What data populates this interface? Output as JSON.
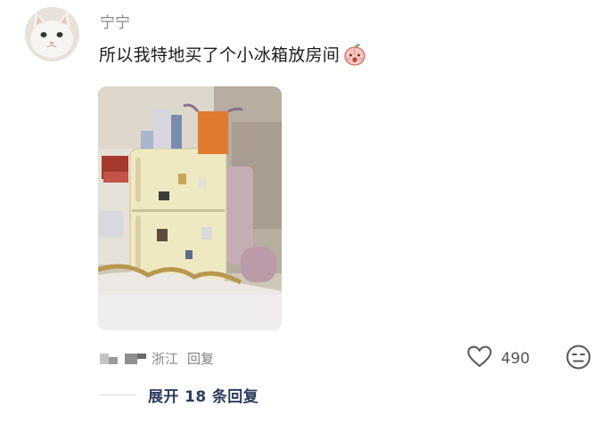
{
  "comment": {
    "username": "宁宁",
    "text": "所以我特地买了个小冰箱放房间",
    "emoji": "peach-face-emoji",
    "location": "浙江",
    "reply_label": "回复",
    "likes": "490",
    "expand_label": "展开 18 条回复"
  },
  "colors": {
    "username": "#8a8a8a",
    "text": "#1c1c1c",
    "meta": "#8c8c8c",
    "expand": "#2b3d5e",
    "fridge": "#efe9c2"
  }
}
